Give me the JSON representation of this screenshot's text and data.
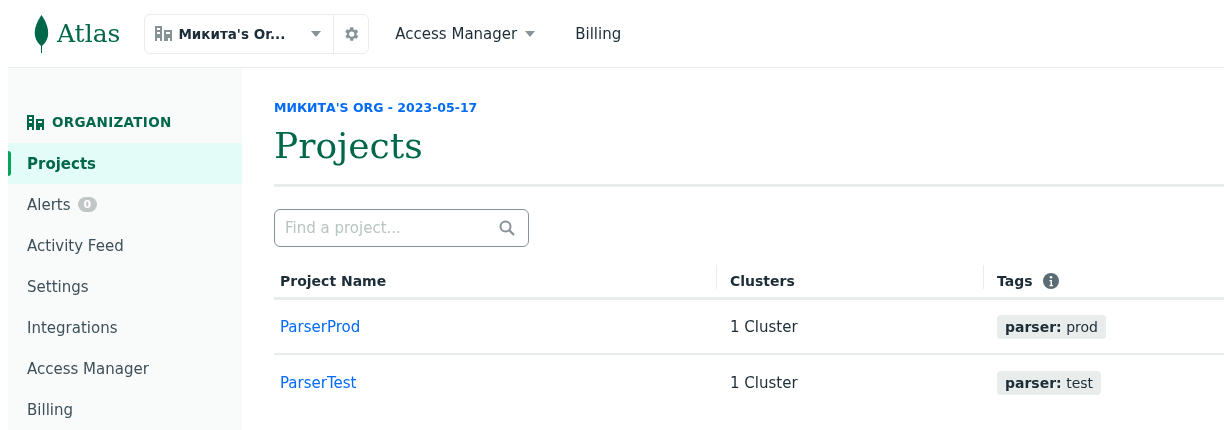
{
  "topbar": {
    "logo": "Atlas",
    "org_selector": "Микита's Or...",
    "nav": [
      {
        "label": "Access Manager",
        "dropdown": true
      },
      {
        "label": "Billing",
        "dropdown": false
      }
    ]
  },
  "sidebar": {
    "heading": "ORGANIZATION",
    "items": [
      {
        "label": "Projects",
        "selected": true
      },
      {
        "label": "Alerts",
        "selected": false,
        "badge": "0"
      },
      {
        "label": "Activity Feed",
        "selected": false
      },
      {
        "label": "Settings",
        "selected": false
      },
      {
        "label": "Integrations",
        "selected": false
      },
      {
        "label": "Access Manager",
        "selected": false
      },
      {
        "label": "Billing",
        "selected": false
      }
    ]
  },
  "main": {
    "breadcrumb": "МИКИТА'S ORG - 2023-05-17",
    "title": "Projects",
    "search": {
      "placeholder": "Find a project..."
    },
    "table": {
      "columns": [
        {
          "label": "Project Name",
          "info": false
        },
        {
          "label": "Clusters",
          "info": false
        },
        {
          "label": "Tags",
          "info": true
        }
      ],
      "rows": [
        {
          "name": "ParserProd",
          "clusters": "1 Cluster",
          "tags": [
            "**parser:** prod"
          ]
        },
        {
          "name": "ParserTest",
          "clusters": "1 Cluster",
          "tags": [
            "**parser:** test"
          ]
        }
      ]
    }
  }
}
